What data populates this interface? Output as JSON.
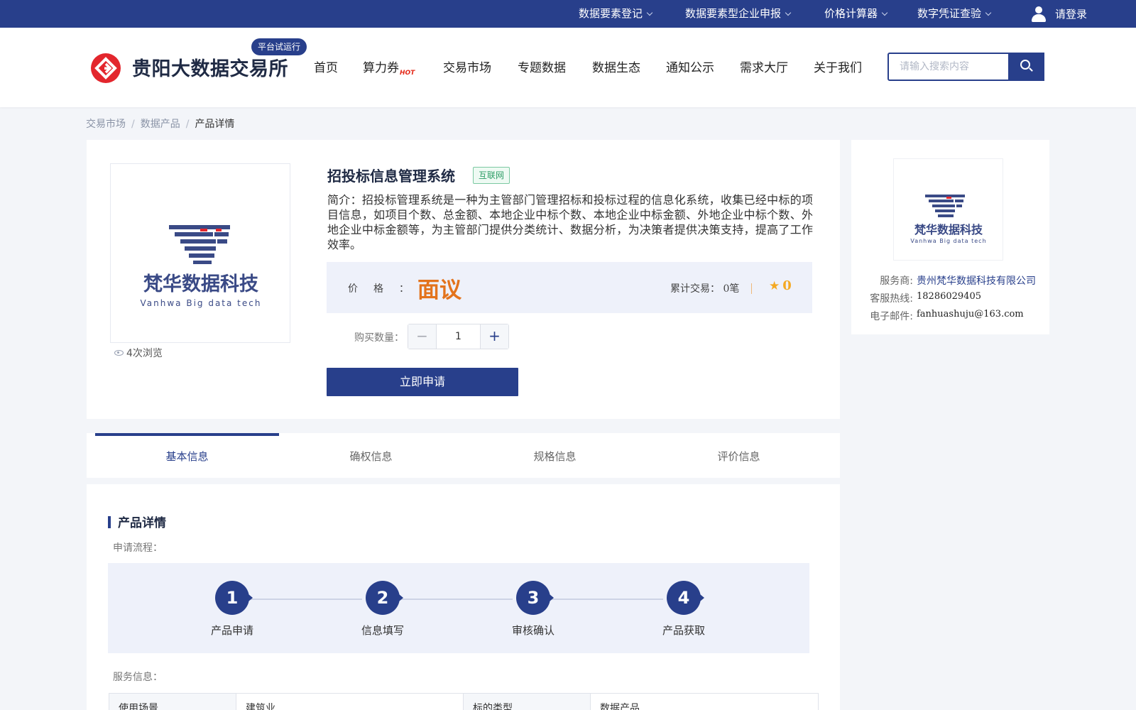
{
  "topbar": {
    "items": [
      "数据要素登记",
      "数据要素型企业申报",
      "价格计算器",
      "数字凭证查验"
    ],
    "login": "请登录"
  },
  "header": {
    "site_name": "贵阳大数据交易所",
    "trial_badge": "平台试运行",
    "nav": [
      "首页",
      "算力券",
      "交易市场",
      "专题数据",
      "数据生态",
      "通知公示",
      "需求大厅",
      "关于我们"
    ],
    "hot_badge": "HOT",
    "search_placeholder": "请输入搜索内容"
  },
  "breadcrumb": [
    "交易市场",
    "数据产品",
    "产品详情"
  ],
  "product": {
    "title": "招投标信息管理系统",
    "tag": "互联网",
    "description": "简介：招投标管理系统是一种为主管部门管理招标和投标过程的信息化系统，收集已经中标的项目信息，如项目个数、总金额、本地企业中标个数、本地企业中标金额、外地企业中标个数、外地企业中标金额等，为主管部门提供分类统计、数据分析，为决策者提供决策支持，提高了工作效率。",
    "views": "4次浏览",
    "price_label": "价格：",
    "price_value": "面议",
    "trade_count_label": "累计交易：",
    "trade_count": "0笔",
    "rating": "0",
    "qty_label": "购买数量：",
    "qty_value": "1",
    "apply_button": "立即申请",
    "image_logo_text": "梵华数据科技",
    "image_logo_sub": "Vanhwa Big data tech"
  },
  "provider": {
    "rows": [
      {
        "key": "服务商:",
        "value": "贵州梵华数据科技有限公司"
      },
      {
        "key": "客服热线:",
        "value": "18286029405"
      },
      {
        "key": "电子邮件:",
        "value": "fanhuashuju@163.com"
      }
    ]
  },
  "tabs": [
    "基本信息",
    "确权信息",
    "规格信息",
    "评价信息"
  ],
  "detail": {
    "section_title": "产品详情",
    "process_label": "申请流程：",
    "steps": [
      {
        "num": "1",
        "label": "产品申请"
      },
      {
        "num": "2",
        "label": "信息填写"
      },
      {
        "num": "3",
        "label": "审核确认"
      },
      {
        "num": "4",
        "label": "产品获取"
      }
    ],
    "service_label": "服务信息：",
    "table": [
      {
        "k1": "使用场景",
        "v1": "建筑业",
        "k2": "标的类型",
        "v2": "数据产品"
      }
    ]
  },
  "colors": {
    "primary": "#283f8b",
    "price": "#e3731c",
    "star": "#f4a923",
    "tag_green": "#2f9e67"
  }
}
